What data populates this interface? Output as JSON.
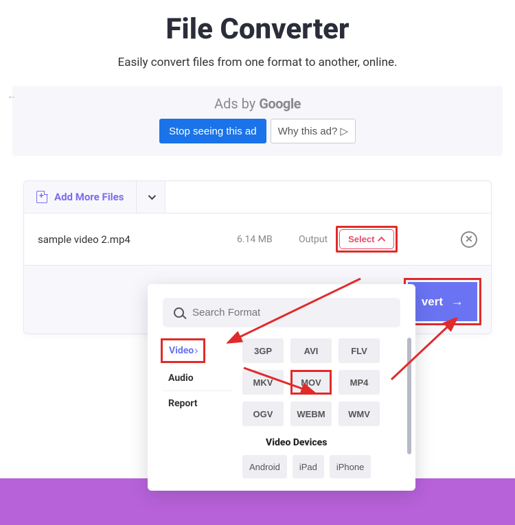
{
  "header": {
    "title": "File Converter",
    "subtitle": "Easily convert files from one format to another, online."
  },
  "ad": {
    "prefix": "Ads by",
    "brand": "Google",
    "stop_label": "Stop seeing this ad",
    "why_label": "Why this ad? ▷"
  },
  "card": {
    "add_more_label": "Add More Files",
    "file": {
      "name": "sample video 2.mp4",
      "size": "6.14 MB",
      "output_label": "Output",
      "select_label": "Select"
    },
    "convert_label": "vert"
  },
  "popup": {
    "search_placeholder": "Search Format",
    "categories": {
      "video": "Video",
      "audio": "Audio",
      "report": "Report"
    },
    "formats": {
      "row1": [
        "3GP",
        "AVI",
        "FLV"
      ],
      "row2": [
        "MKV",
        "MOV",
        "MP4"
      ],
      "row3": [
        "OGV",
        "WEBM",
        "WMV"
      ]
    },
    "devices_title": "Video Devices",
    "devices": [
      "Android",
      "iPad",
      "iPhone"
    ]
  },
  "annotations": {
    "highlight_color": "#e12a2a",
    "highlighted": [
      "select-button",
      "convert-button",
      "category-video",
      "format-mov"
    ]
  }
}
